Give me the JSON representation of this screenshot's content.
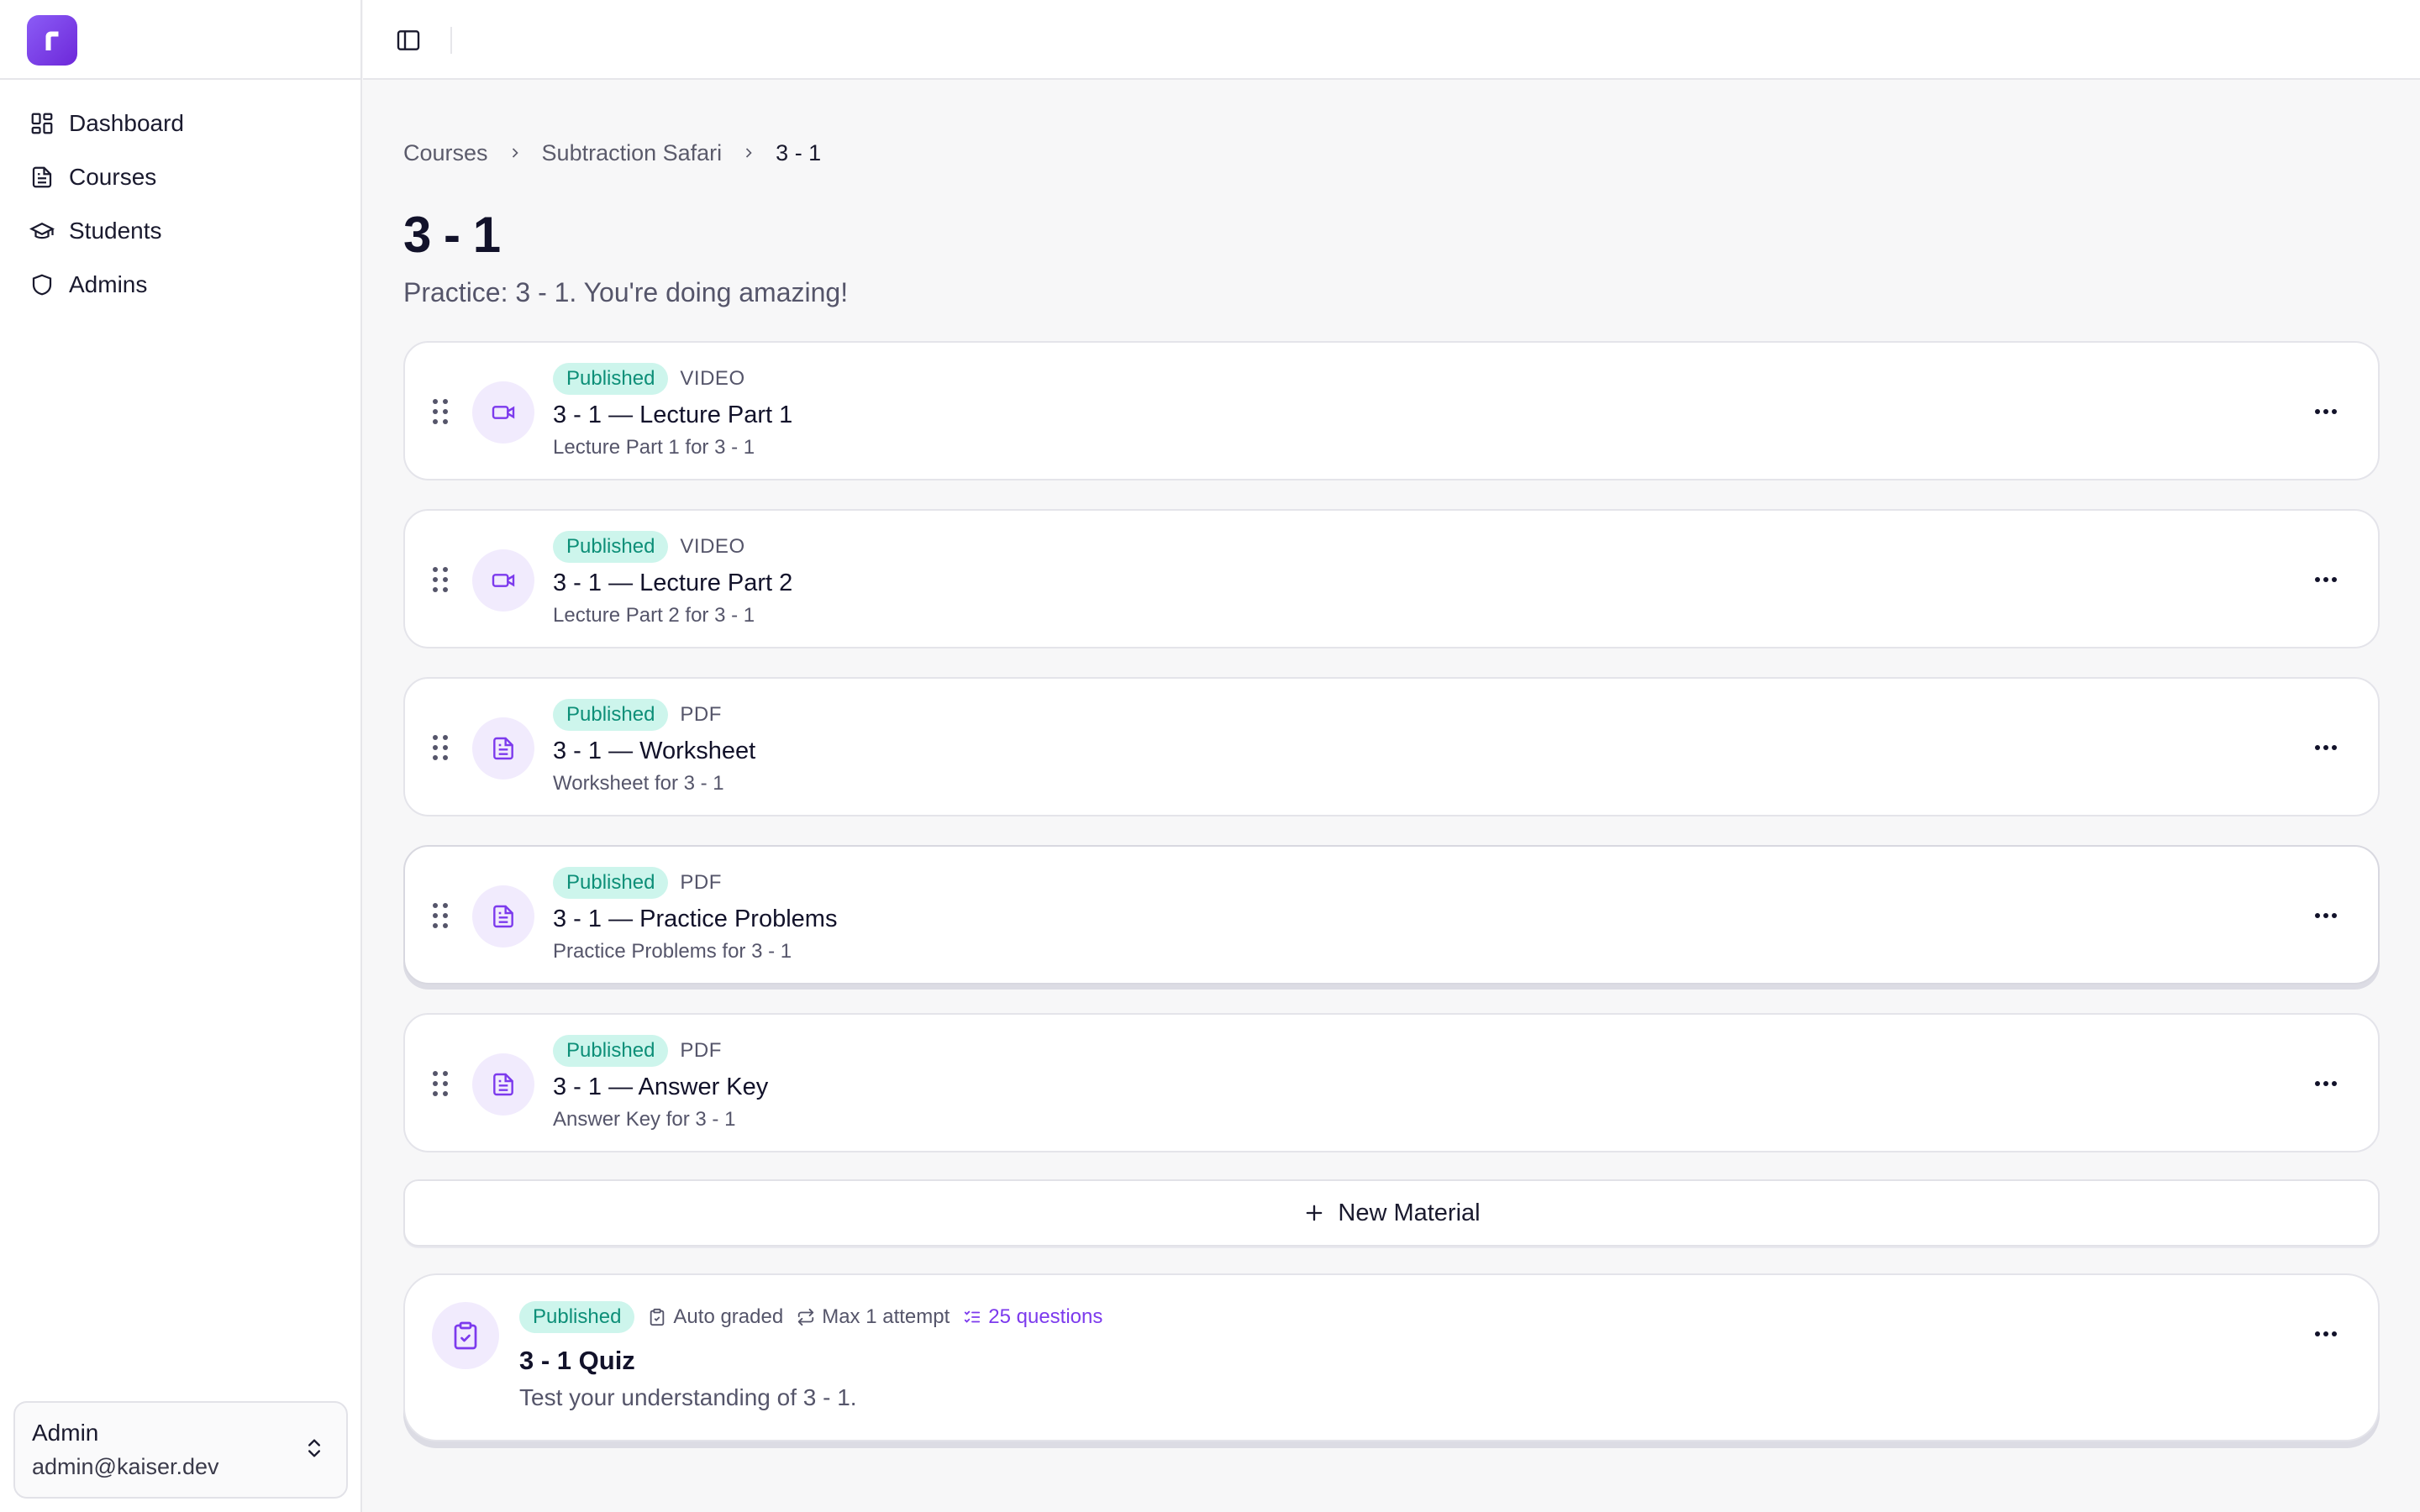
{
  "sidebar": {
    "logo_letter": "r",
    "items": [
      {
        "label": "Dashboard",
        "icon": "dashboard-icon"
      },
      {
        "label": "Courses",
        "icon": "document-icon"
      },
      {
        "label": "Students",
        "icon": "graduation-cap-icon"
      },
      {
        "label": "Admins",
        "icon": "shield-icon"
      }
    ],
    "user": {
      "name": "Admin",
      "email": "admin@kaiser.dev"
    }
  },
  "breadcrumb": {
    "items": [
      "Courses",
      "Subtraction Safari"
    ],
    "current": "3 - 1"
  },
  "page": {
    "title": "3 - 1",
    "subtitle": "Practice: 3 - 1. You're doing amazing!"
  },
  "materials": [
    {
      "status": "Published",
      "type": "VIDEO",
      "title": "3 - 1 — Lecture Part 1",
      "description": "Lecture Part 1 for 3 - 1",
      "icon": "video-icon"
    },
    {
      "status": "Published",
      "type": "VIDEO",
      "title": "3 - 1 — Lecture Part 2",
      "description": "Lecture Part 2 for 3 - 1",
      "icon": "video-icon"
    },
    {
      "status": "Published",
      "type": "PDF",
      "title": "3 - 1 — Worksheet",
      "description": "Worksheet for 3 - 1",
      "icon": "file-text-icon"
    },
    {
      "status": "Published",
      "type": "PDF",
      "title": "3 - 1 — Practice Problems",
      "description": "Practice Problems for 3 - 1",
      "icon": "file-text-icon"
    },
    {
      "status": "Published",
      "type": "PDF",
      "title": "3 - 1 — Answer Key",
      "description": "Answer Key for 3 - 1",
      "icon": "file-text-icon"
    }
  ],
  "new_material_label": "New Material",
  "quiz": {
    "status": "Published",
    "grading": "Auto graded",
    "attempts": "Max 1 attempt",
    "questions": "25 questions",
    "title": "3 - 1 Quiz",
    "description": "Test your understanding of 3 - 1."
  },
  "colors": {
    "accent": "#7c3aed",
    "badge_bg": "#cdf5ec",
    "badge_text": "#0d8f78"
  }
}
